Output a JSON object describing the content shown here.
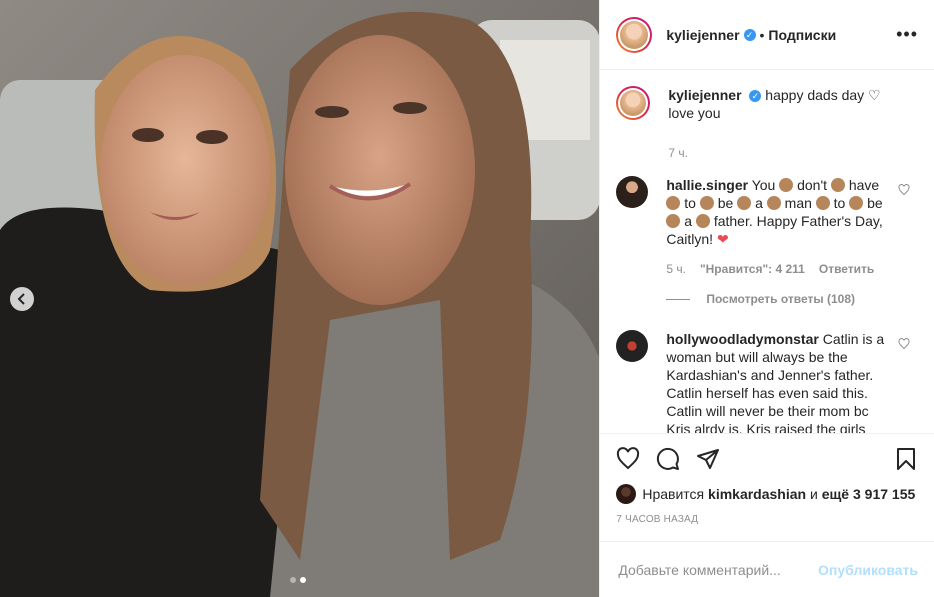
{
  "header": {
    "username": "kyliejenner",
    "separator": "•",
    "follow_label": "Подписки",
    "more_icon": "more-horizontal-icon"
  },
  "caption": {
    "username": "kyliejenner",
    "text": "happy dads day ♡ love you",
    "time": "7 ч."
  },
  "comments": [
    {
      "username": "hallie.singer",
      "parts": [
        "You",
        "don't",
        "have",
        "to",
        "be",
        "a",
        "man",
        "to",
        "be",
        "a",
        "father."
      ],
      "tail": "Happy Father's Day, Caitlyn!",
      "time": "5 ч.",
      "likes": "\"Нравится\": 4 211",
      "reply_label": "Ответить",
      "view_replies": "Посмотреть ответы (108)"
    },
    {
      "username": "hollywoodladymonstar",
      "text": "Catlin is a woman but will always be the Kardashian's and Jenner's father. Catlin herself has even said this. Catlin will never be their mom bc Kris alrdy is. Kris raised the girls"
    }
  ],
  "likes": {
    "prefix": "Нравится",
    "user": "kimkardashian",
    "middle": "и",
    "others": "ещё 3 917 155"
  },
  "timestamp": "7 ЧАСОВ НАЗАД",
  "comment_box": {
    "placeholder": "Добавьте комментарий...",
    "publish_label": "Опубликовать"
  },
  "colors": {
    "verified": "#3897f0",
    "publish_disabled": "#b2dffc",
    "like_heart": "#ed4956"
  }
}
